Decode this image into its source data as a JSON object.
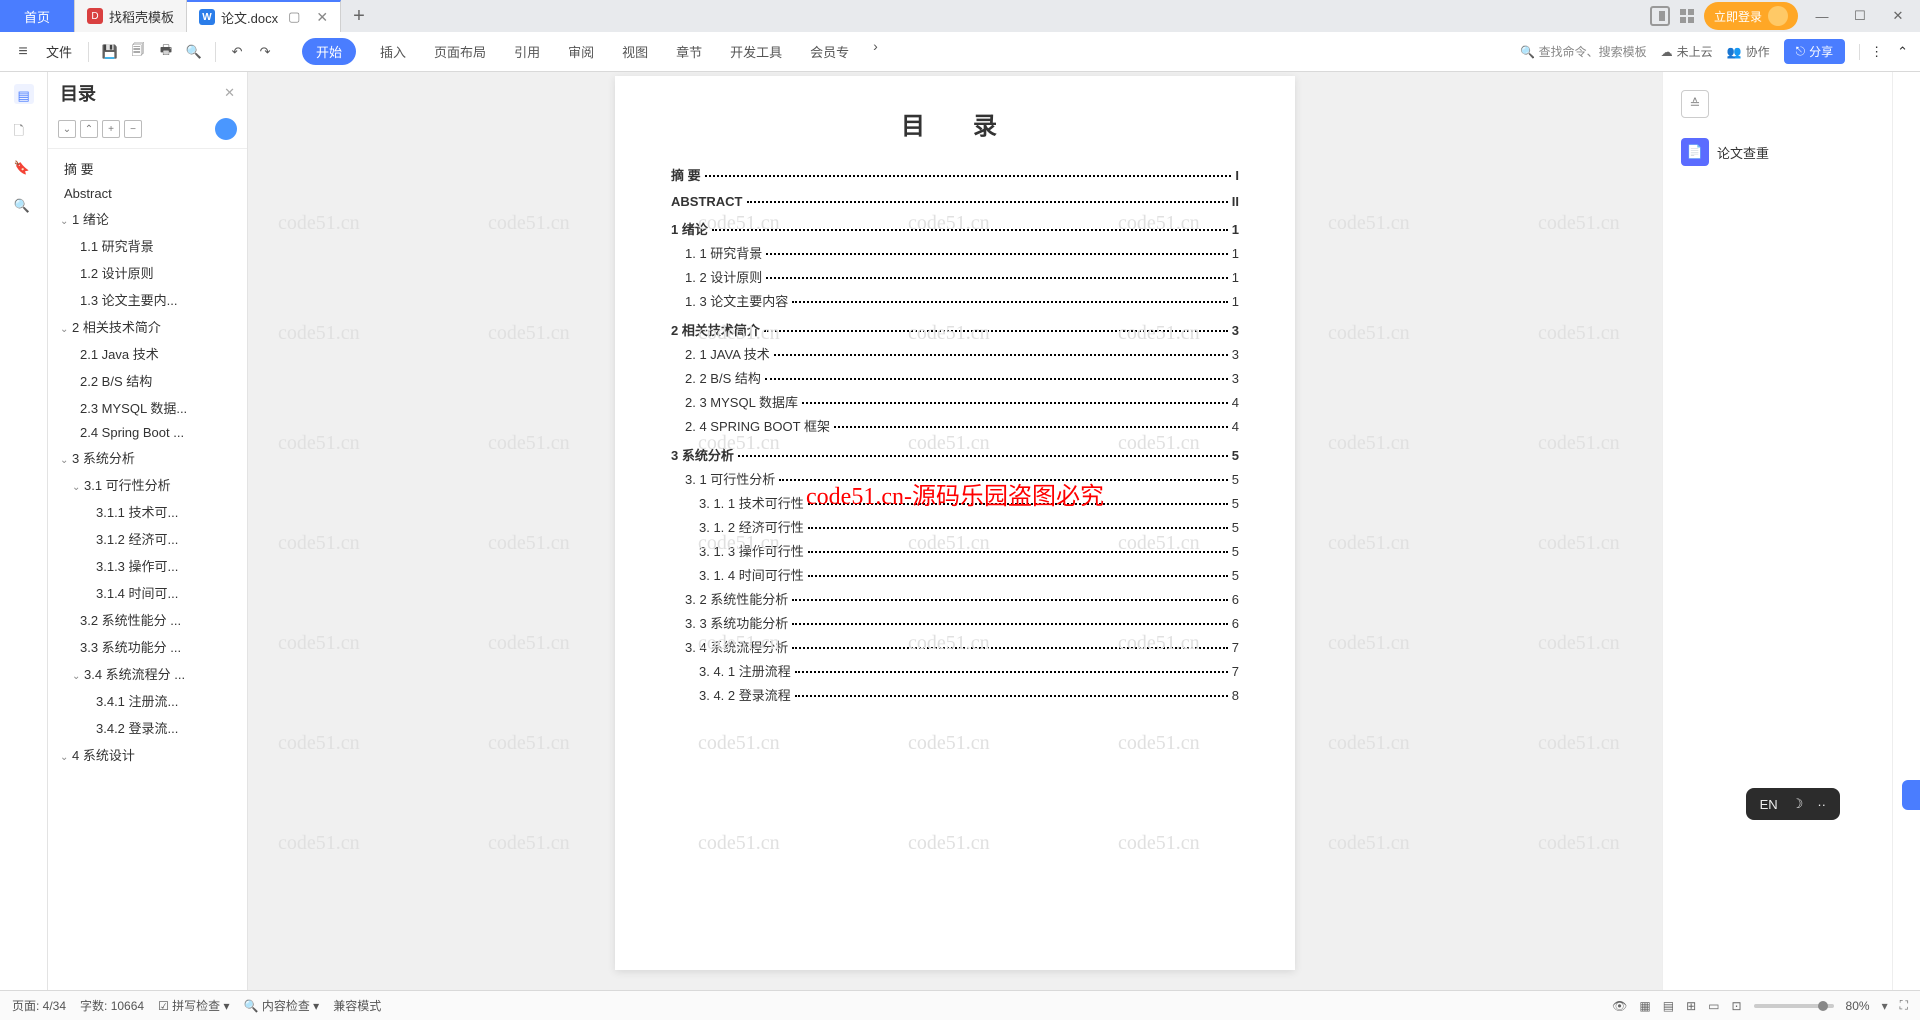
{
  "tabs": {
    "home": "首页",
    "template": "找稻壳模板",
    "doc": "论文.docx"
  },
  "top": {
    "login": "立即登录"
  },
  "ribbon": {
    "file": "文件",
    "tabs": [
      "开始",
      "插入",
      "页面布局",
      "引用",
      "审阅",
      "视图",
      "章节",
      "开发工具",
      "会员专"
    ],
    "search_placeholder": "查找命令、搜索模板",
    "cloud": "未上云",
    "collab": "协作",
    "share": "分享"
  },
  "toc": {
    "title": "目录",
    "items": [
      {
        "t": "摘 要",
        "l": 0
      },
      {
        "t": "Abstract",
        "l": 0
      },
      {
        "t": "1  绪论",
        "l": 1,
        "exp": true
      },
      {
        "t": "1.1 研究背景",
        "l": 2
      },
      {
        "t": "1.2 设计原则",
        "l": 2
      },
      {
        "t": "1.3 论文主要内...",
        "l": 2
      },
      {
        "t": "2  相关技术简介",
        "l": 1,
        "exp": true
      },
      {
        "t": "2.1 Java 技术",
        "l": 2
      },
      {
        "t": "2.2 B/S 结构",
        "l": 2
      },
      {
        "t": "2.3 MYSQL 数据...",
        "l": 2
      },
      {
        "t": "2.4 Spring Boot ...",
        "l": 2
      },
      {
        "t": "3  系统分析",
        "l": 1,
        "exp": true
      },
      {
        "t": "3.1  可行性分析",
        "l": "1b",
        "exp": true
      },
      {
        "t": "3.1.1  技术可...",
        "l": 3
      },
      {
        "t": "3.1.2  经济可...",
        "l": 3
      },
      {
        "t": "3.1.3  操作可...",
        "l": 3
      },
      {
        "t": "3.1.4  时间可...",
        "l": 3
      },
      {
        "t": "3.2  系统性能分 ...",
        "l": 2
      },
      {
        "t": "3.3  系统功能分 ...",
        "l": 2
      },
      {
        "t": "3.4  系统流程分 ...",
        "l": "1b",
        "exp": true
      },
      {
        "t": "3.4.1  注册流...",
        "l": 3
      },
      {
        "t": "3.4.2  登录流...",
        "l": 3
      },
      {
        "t": "4  系统设计",
        "l": 1,
        "exp": true
      }
    ]
  },
  "doc": {
    "title": "目　录",
    "lines": [
      {
        "k": "摘  要",
        "p": "I",
        "h": 1
      },
      {
        "k": "ABSTRACT",
        "p": "II",
        "h": 1
      },
      {
        "k": "1  绪论",
        "p": "1",
        "h": 1
      },
      {
        "k": "1. 1 研究背景",
        "p": "1",
        "i": 1
      },
      {
        "k": "1. 2 设计原则",
        "p": "1",
        "i": 1
      },
      {
        "k": "1. 3 论文主要内容",
        "p": "1",
        "i": 1
      },
      {
        "k": "2  相关技术简介",
        "p": "3",
        "h": 1
      },
      {
        "k": "2. 1 JAVA 技术",
        "p": "3",
        "i": 1
      },
      {
        "k": "2. 2 B/S 结构",
        "p": "3",
        "i": 1
      },
      {
        "k": "2. 3 MYSQL 数据库",
        "p": "4",
        "i": 1
      },
      {
        "k": "2. 4 SPRING BOOT 框架",
        "p": "4",
        "i": 1
      },
      {
        "k": "3  系统分析",
        "p": "5",
        "h": 1
      },
      {
        "k": "3. 1 可行性分析",
        "p": "5",
        "i": 1
      },
      {
        "k": "3. 1. 1  技术可行性",
        "p": "5",
        "i": 2
      },
      {
        "k": "3. 1. 2  经济可行性",
        "p": "5",
        "i": 2
      },
      {
        "k": "3. 1. 3  操作可行性",
        "p": "5",
        "i": 2
      },
      {
        "k": "3. 1. 4  时间可行性",
        "p": "5",
        "i": 2
      },
      {
        "k": "3. 2 系统性能分析",
        "p": "6",
        "i": 1
      },
      {
        "k": "3. 3 系统功能分析",
        "p": "6",
        "i": 1
      },
      {
        "k": "3. 4 系统流程分析",
        "p": "7",
        "i": 1
      },
      {
        "k": "3. 4. 1  注册流程",
        "p": "7",
        "i": 2
      },
      {
        "k": "3. 4. 2  登录流程",
        "p": "8",
        "i": 2
      }
    ],
    "overlay": "code51.cn-源码乐园盗图必究",
    "wm": "code51.cn"
  },
  "rightPanel": {
    "check": "论文查重"
  },
  "floatBar": {
    "lang": "EN"
  },
  "status": {
    "page": "页面: 4/34",
    "words": "字数: 10664",
    "spell": "拼写检查",
    "content": "内容检查",
    "compat": "兼容模式",
    "zoom": "80%"
  }
}
